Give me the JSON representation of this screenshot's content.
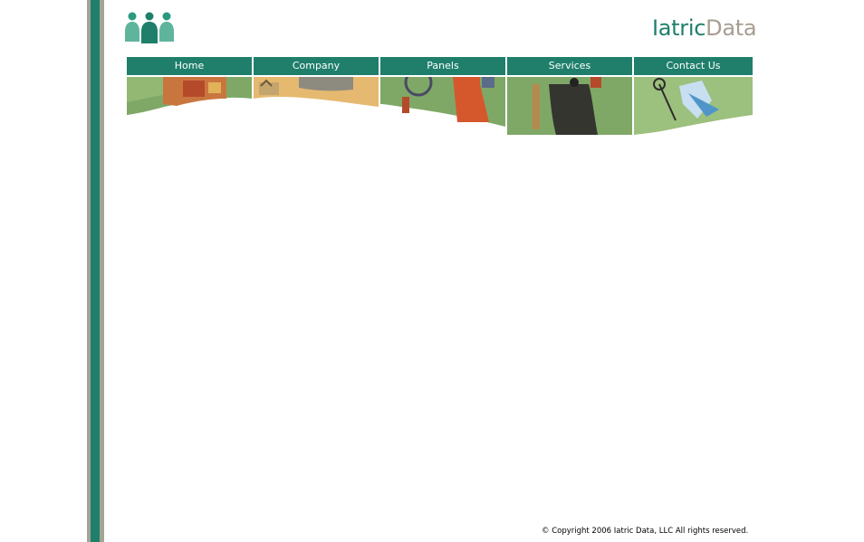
{
  "brand": {
    "part1": "Iatric",
    "part2": "Data",
    "logo_icon": "three-people-icon"
  },
  "nav": {
    "items": [
      {
        "label": "Home"
      },
      {
        "label": "Company"
      },
      {
        "label": "Panels"
      },
      {
        "label": "Services"
      },
      {
        "label": "Contact Us"
      }
    ]
  },
  "footer": {
    "copyright": "© Copyright 2006 Iatric Data, LLC All rights reserved."
  },
  "colors": {
    "primary": "#1f7f6b",
    "stripe_gray": "#a3a495",
    "brand_secondary": "#a79d91"
  }
}
